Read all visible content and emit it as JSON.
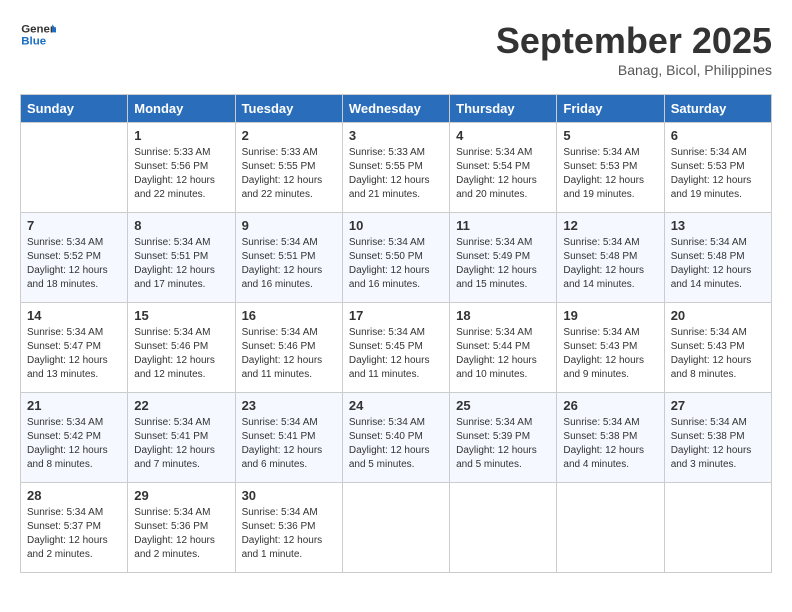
{
  "header": {
    "logo_line1": "General",
    "logo_line2": "Blue",
    "month": "September 2025",
    "location": "Banag, Bicol, Philippines"
  },
  "days_of_week": [
    "Sunday",
    "Monday",
    "Tuesday",
    "Wednesday",
    "Thursday",
    "Friday",
    "Saturday"
  ],
  "weeks": [
    [
      {
        "day": "",
        "detail": ""
      },
      {
        "day": "1",
        "detail": "Sunrise: 5:33 AM\nSunset: 5:56 PM\nDaylight: 12 hours\nand 22 minutes."
      },
      {
        "day": "2",
        "detail": "Sunrise: 5:33 AM\nSunset: 5:55 PM\nDaylight: 12 hours\nand 22 minutes."
      },
      {
        "day": "3",
        "detail": "Sunrise: 5:33 AM\nSunset: 5:55 PM\nDaylight: 12 hours\nand 21 minutes."
      },
      {
        "day": "4",
        "detail": "Sunrise: 5:34 AM\nSunset: 5:54 PM\nDaylight: 12 hours\nand 20 minutes."
      },
      {
        "day": "5",
        "detail": "Sunrise: 5:34 AM\nSunset: 5:53 PM\nDaylight: 12 hours\nand 19 minutes."
      },
      {
        "day": "6",
        "detail": "Sunrise: 5:34 AM\nSunset: 5:53 PM\nDaylight: 12 hours\nand 19 minutes."
      }
    ],
    [
      {
        "day": "7",
        "detail": "Sunrise: 5:34 AM\nSunset: 5:52 PM\nDaylight: 12 hours\nand 18 minutes."
      },
      {
        "day": "8",
        "detail": "Sunrise: 5:34 AM\nSunset: 5:51 PM\nDaylight: 12 hours\nand 17 minutes."
      },
      {
        "day": "9",
        "detail": "Sunrise: 5:34 AM\nSunset: 5:51 PM\nDaylight: 12 hours\nand 16 minutes."
      },
      {
        "day": "10",
        "detail": "Sunrise: 5:34 AM\nSunset: 5:50 PM\nDaylight: 12 hours\nand 16 minutes."
      },
      {
        "day": "11",
        "detail": "Sunrise: 5:34 AM\nSunset: 5:49 PM\nDaylight: 12 hours\nand 15 minutes."
      },
      {
        "day": "12",
        "detail": "Sunrise: 5:34 AM\nSunset: 5:48 PM\nDaylight: 12 hours\nand 14 minutes."
      },
      {
        "day": "13",
        "detail": "Sunrise: 5:34 AM\nSunset: 5:48 PM\nDaylight: 12 hours\nand 14 minutes."
      }
    ],
    [
      {
        "day": "14",
        "detail": "Sunrise: 5:34 AM\nSunset: 5:47 PM\nDaylight: 12 hours\nand 13 minutes."
      },
      {
        "day": "15",
        "detail": "Sunrise: 5:34 AM\nSunset: 5:46 PM\nDaylight: 12 hours\nand 12 minutes."
      },
      {
        "day": "16",
        "detail": "Sunrise: 5:34 AM\nSunset: 5:46 PM\nDaylight: 12 hours\nand 11 minutes."
      },
      {
        "day": "17",
        "detail": "Sunrise: 5:34 AM\nSunset: 5:45 PM\nDaylight: 12 hours\nand 11 minutes."
      },
      {
        "day": "18",
        "detail": "Sunrise: 5:34 AM\nSunset: 5:44 PM\nDaylight: 12 hours\nand 10 minutes."
      },
      {
        "day": "19",
        "detail": "Sunrise: 5:34 AM\nSunset: 5:43 PM\nDaylight: 12 hours\nand 9 minutes."
      },
      {
        "day": "20",
        "detail": "Sunrise: 5:34 AM\nSunset: 5:43 PM\nDaylight: 12 hours\nand 8 minutes."
      }
    ],
    [
      {
        "day": "21",
        "detail": "Sunrise: 5:34 AM\nSunset: 5:42 PM\nDaylight: 12 hours\nand 8 minutes."
      },
      {
        "day": "22",
        "detail": "Sunrise: 5:34 AM\nSunset: 5:41 PM\nDaylight: 12 hours\nand 7 minutes."
      },
      {
        "day": "23",
        "detail": "Sunrise: 5:34 AM\nSunset: 5:41 PM\nDaylight: 12 hours\nand 6 minutes."
      },
      {
        "day": "24",
        "detail": "Sunrise: 5:34 AM\nSunset: 5:40 PM\nDaylight: 12 hours\nand 5 minutes."
      },
      {
        "day": "25",
        "detail": "Sunrise: 5:34 AM\nSunset: 5:39 PM\nDaylight: 12 hours\nand 5 minutes."
      },
      {
        "day": "26",
        "detail": "Sunrise: 5:34 AM\nSunset: 5:38 PM\nDaylight: 12 hours\nand 4 minutes."
      },
      {
        "day": "27",
        "detail": "Sunrise: 5:34 AM\nSunset: 5:38 PM\nDaylight: 12 hours\nand 3 minutes."
      }
    ],
    [
      {
        "day": "28",
        "detail": "Sunrise: 5:34 AM\nSunset: 5:37 PM\nDaylight: 12 hours\nand 2 minutes."
      },
      {
        "day": "29",
        "detail": "Sunrise: 5:34 AM\nSunset: 5:36 PM\nDaylight: 12 hours\nand 2 minutes."
      },
      {
        "day": "30",
        "detail": "Sunrise: 5:34 AM\nSunset: 5:36 PM\nDaylight: 12 hours\nand 1 minute."
      },
      {
        "day": "",
        "detail": ""
      },
      {
        "day": "",
        "detail": ""
      },
      {
        "day": "",
        "detail": ""
      },
      {
        "day": "",
        "detail": ""
      }
    ]
  ]
}
